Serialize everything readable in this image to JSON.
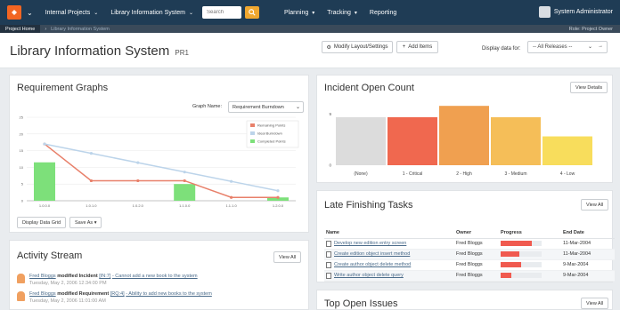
{
  "nav": {
    "items": [
      "Internal Projects",
      "Library Information System"
    ],
    "search_placeholder": "Search",
    "menus": [
      "Planning",
      "Tracking",
      "Reporting"
    ],
    "user": "System Administrator"
  },
  "breadcrumb": {
    "home": "Project Home",
    "current": "Library Information System",
    "role": "Role: Project Owner"
  },
  "header": {
    "title": "Library Information System",
    "code": "PR1",
    "modify_label": "Modify Layout/Settings",
    "add_items_label": "Add Items",
    "display_for_label": "Display data for:",
    "release_value": "-- All Releases --"
  },
  "requirement_graphs": {
    "title": "Requirement Graphs",
    "graph_name_label": "Graph Name:",
    "graph_name_value": "Requirement Burndown",
    "display_grid_label": "Display Data Grid",
    "save_as_label": "Save As"
  },
  "chart_data": [
    {
      "type": "bar",
      "title": "",
      "categories": [
        "1.0.0.0",
        "1.0.1.0",
        "1.0.2.0",
        "1.1.0.0",
        "1.1.1.0",
        "1.2.0.0"
      ],
      "yticks": [
        0,
        5,
        10,
        15,
        20,
        25
      ],
      "ylim": [
        0,
        25
      ],
      "legend_position": "top-right",
      "series": [
        {
          "name": "Remaining Points",
          "type": "line",
          "color": "#e8806a",
          "values": [
            17,
            6,
            6,
            6,
            1,
            1
          ]
        },
        {
          "name": "Ideal Burndown",
          "type": "line",
          "color": "#bcd4ea",
          "values": [
            17,
            14.2,
            11.4,
            8.6,
            5.8,
            3
          ]
        },
        {
          "name": "Completed Points",
          "type": "bar",
          "color": "#7de07a",
          "values": [
            11.5,
            0,
            0,
            5,
            0,
            1
          ]
        }
      ]
    },
    {
      "type": "bar",
      "title": "",
      "categories": [
        "(None)",
        "1 - Critical",
        "2 - High",
        "3 - Medium",
        "4 - Low"
      ],
      "yticks": [
        0,
        9
      ],
      "ylim": [
        0,
        11
      ],
      "values": [
        8.5,
        8.5,
        10.5,
        8.5,
        5.1
      ],
      "colors": [
        "#dcdcdc",
        "#f0684f",
        "#f0a050",
        "#f5be58",
        "#f8dd5c"
      ]
    }
  ],
  "incident_open_count": {
    "title": "Incident Open Count",
    "view_details_label": "View Details"
  },
  "late_tasks": {
    "title": "Late Finishing Tasks",
    "view_all_label": "View All",
    "columns": [
      "Name",
      "Owner",
      "Progress",
      "End Date"
    ],
    "rows": [
      {
        "name": "Develop new edition entry screen",
        "owner": "Fred Bloggs",
        "progress": 0.75,
        "end_date": "11-Mar-2004"
      },
      {
        "name": "Create edition object insert method",
        "owner": "Fred Bloggs",
        "progress": 0.45,
        "end_date": "11-Mar-2004"
      },
      {
        "name": "Create author object delete method",
        "owner": "Fred Bloggs",
        "progress": 0.5,
        "end_date": "9-Mar-2004"
      },
      {
        "name": "Write author object delete query",
        "owner": "Fred Bloggs",
        "progress": 0.25,
        "end_date": "9-Mar-2004"
      }
    ]
  },
  "activity": {
    "title": "Activity Stream",
    "view_all_label": "View All",
    "items": [
      {
        "user": "Fred Bloggs",
        "action": "modified Incident",
        "ref": "[IN:7]",
        "desc": "- Cannot add a new book to the system",
        "date": "Tuesday, May 2, 2006 12:34:00 PM"
      },
      {
        "user": "Fred Bloggs",
        "action": "modified Requirement",
        "ref": "[RQ:4]",
        "desc": "- Ability to add new books to the system",
        "date": "Tuesday, May 2, 2006 11:01:00 AM"
      }
    ]
  },
  "top_open_issues": {
    "title": "Top Open Issues",
    "view_all_label": "View All"
  }
}
